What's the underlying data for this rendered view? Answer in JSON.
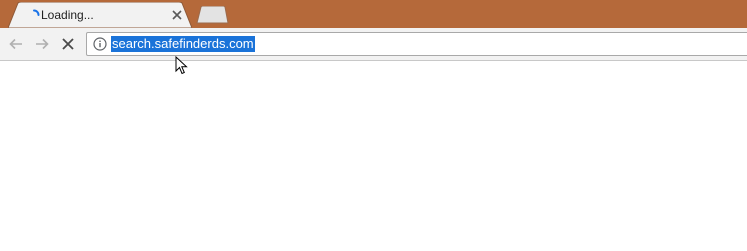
{
  "tab": {
    "title": "Loading...",
    "icon": "loading-spinner-icon",
    "close_icon": "close-icon"
  },
  "new_tab": {
    "icon": "new-tab-icon"
  },
  "toolbar": {
    "back_icon": "back-arrow-icon",
    "forward_icon": "forward-arrow-icon",
    "stop_icon": "stop-icon"
  },
  "omnibox": {
    "info_icon": "info-icon",
    "url": "search.safefinderds.com",
    "url_selected": true
  },
  "colors": {
    "titlebar": "#b5693a",
    "tab_bg": "#f2f2f2",
    "selection": "#1a73d9",
    "spinner": "#1a73e8"
  }
}
